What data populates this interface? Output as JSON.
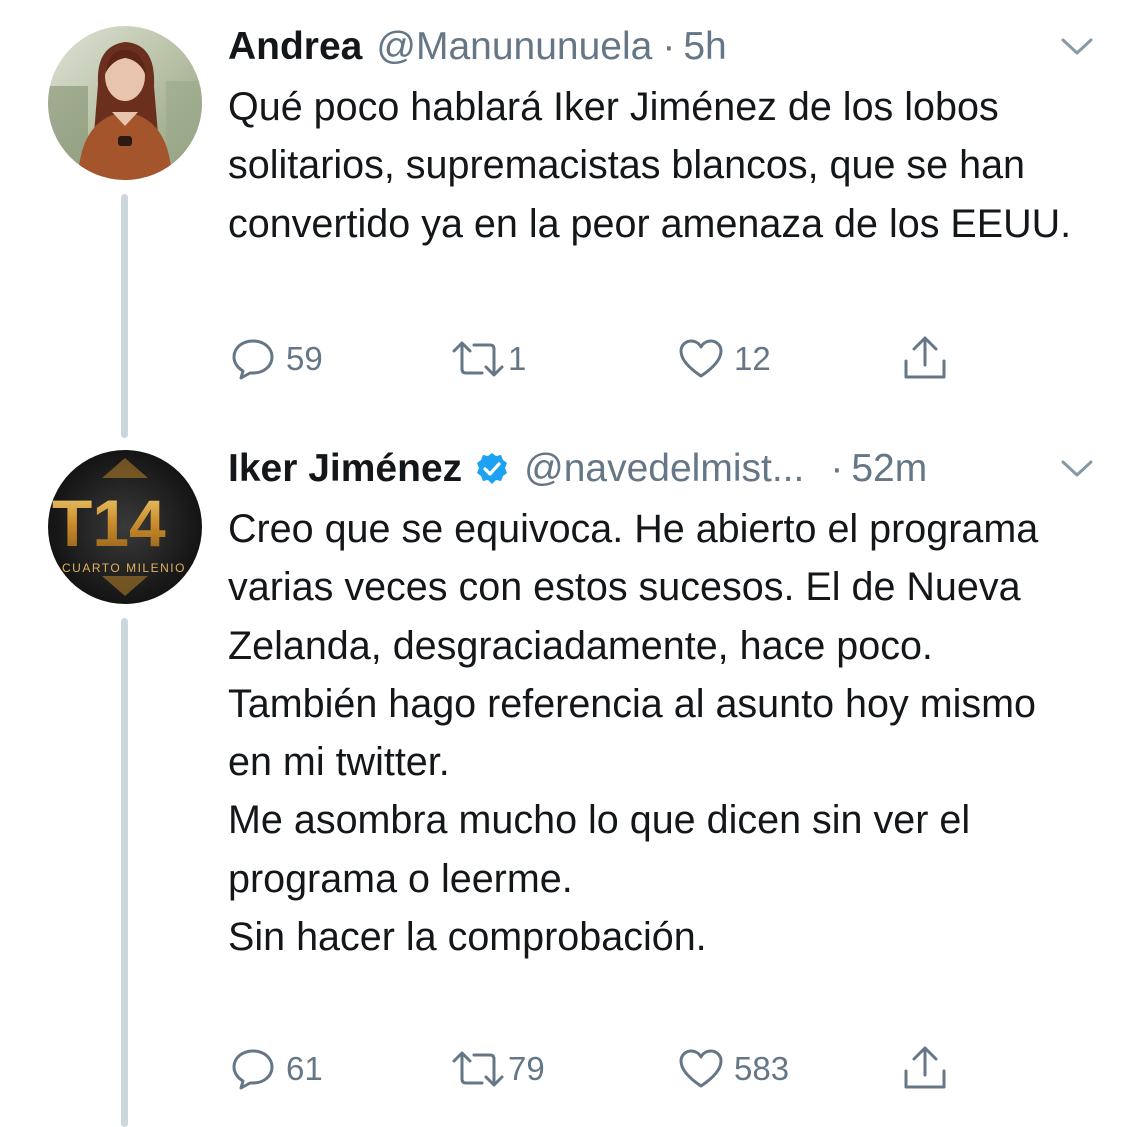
{
  "tweets": [
    {
      "name": "Andrea",
      "handle": "@Manununuela",
      "separator": "·",
      "time": "5h",
      "verified": false,
      "avatar_icon": "person-photo",
      "text_lines": [
        "Qué poco hablará Iker Jiménez de los lobos solitarios, supremacistas blancos, que se han convertido ya en la peor amenaza de los EEUU."
      ],
      "actions": {
        "replies": "59",
        "retweets": "1",
        "likes": "12"
      }
    },
    {
      "name": "Iker Jiménez",
      "handle": "@navedelmist...",
      "separator": "·",
      "time": "52m",
      "verified": true,
      "avatar_icon": "cuarto-milenio-logo",
      "avatar_logo_text": "T14",
      "avatar_logo_subtext": "CUARTO MILENIO",
      "text_lines": [
        "Creo que se equivoca. He abierto el programa varias veces con estos sucesos. El de Nueva Zelanda, desgraciadamente, hace poco. También hago referencia al asunto hoy mismo en mi twitter.",
        "Me asombra mucho lo que dicen sin ver el programa o leerme.",
        "Sin hacer la comprobación."
      ],
      "actions": {
        "replies": "61",
        "retweets": "79",
        "likes": "583"
      }
    }
  ],
  "icons": {
    "reply": "reply-icon",
    "retweet": "retweet-icon",
    "like": "heart-icon",
    "share": "share-icon",
    "caret": "chevron-down-icon",
    "verified": "verified-badge-icon"
  },
  "colors": {
    "text": "#14171a",
    "secondary": "#657786",
    "verified": "#1da1f2",
    "thread_line": "#ccd6dd"
  }
}
